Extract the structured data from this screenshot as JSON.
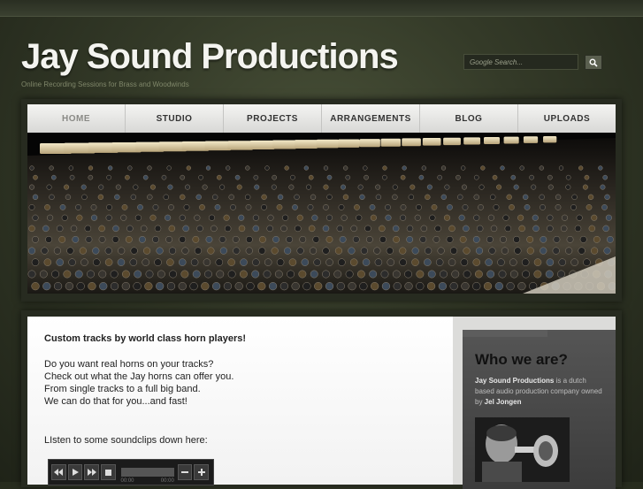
{
  "header": {
    "title": "Jay Sound Productions",
    "tagline": "Online Recording Sessions for Brass and Woodwinds",
    "search_placeholder": "Google Search..."
  },
  "nav": {
    "items": [
      {
        "label": "HOME",
        "active": true
      },
      {
        "label": "STUDIO"
      },
      {
        "label": "PROJECTS"
      },
      {
        "label": "ARRANGEMENTS"
      },
      {
        "label": "BLOG"
      },
      {
        "label": "UPLOADS"
      }
    ]
  },
  "main": {
    "headline": "Custom tracks by world class horn players!",
    "lines": [
      "Do you want real horns on your tracks?",
      "Check out what the Jay horns can offer you.",
      "From single tracks to a full big band.",
      "We can do that for you...and fast!"
    ],
    "listen": "LIsten to some soundclips down here:",
    "player": {
      "time_start": "00:00",
      "time_end": "00:00"
    }
  },
  "sidebar": {
    "heading": "Who we are?",
    "company": "Jay Sound Productions",
    "text_mid": " is a dutch based audio production company owned by ",
    "owner": "Jel Jongen"
  },
  "colors": {
    "background": "#343a28",
    "nav_bg": "#e8e8e6",
    "accent_dark": "#272b20"
  }
}
